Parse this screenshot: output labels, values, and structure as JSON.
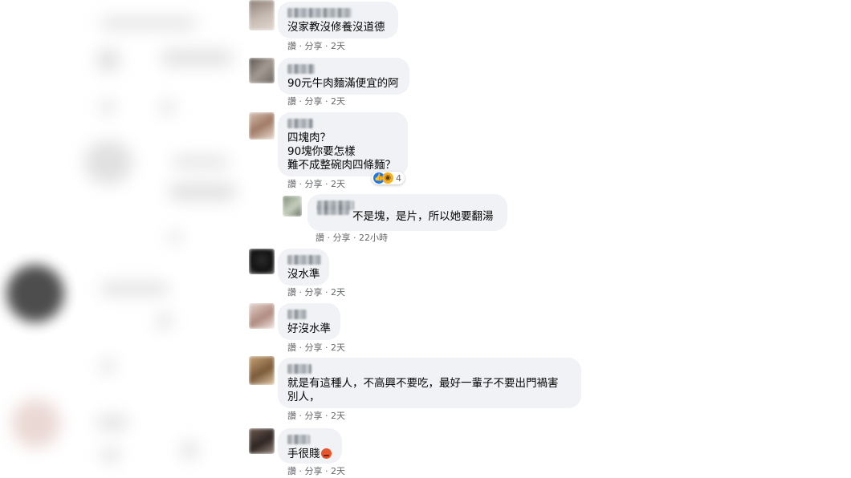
{
  "comments": [
    {
      "text": "沒家教沒修養沒道德",
      "meta": {
        "like": "讚",
        "share": "分享",
        "time": "2天"
      }
    },
    {
      "text": "90元牛肉麵滿便宜的阿",
      "meta": {
        "like": "讚",
        "share": "分享",
        "time": "2天"
      }
    },
    {
      "lines": [
        "四塊肉？",
        "90塊你要怎樣",
        "難不成整碗肉四條麵？"
      ],
      "meta": {
        "like": "讚",
        "share": "分享",
        "time": "2天"
      },
      "reactions": {
        "count": "4",
        "icons": [
          "like-icon",
          "wow-icon"
        ]
      }
    },
    {
      "text": "不是塊，是片，所以她要翻湯",
      "meta": {
        "like": "讚",
        "share": "分享",
        "time": "22小時"
      }
    },
    {
      "text": "沒水準",
      "meta": {
        "like": "讚",
        "share": "分享",
        "time": "2天"
      }
    },
    {
      "text": "好沒水準",
      "meta": {
        "like": "讚",
        "share": "分享",
        "time": "2天"
      }
    },
    {
      "lines": [
        "就是有這種人，不高興不要吃，最好一輩子不要出門禍害",
        "別人，"
      ],
      "meta": {
        "like": "讚",
        "share": "分享",
        "time": "2天"
      }
    },
    {
      "text": "手很賤",
      "emoji": "angry-face-icon",
      "meta": {
        "like": "讚",
        "share": "分享",
        "time": "2天"
      }
    }
  ],
  "colors": {
    "bubble": "#f0f2f5",
    "meta": "#65676b",
    "text": "#050505",
    "like": "#1877f2"
  }
}
